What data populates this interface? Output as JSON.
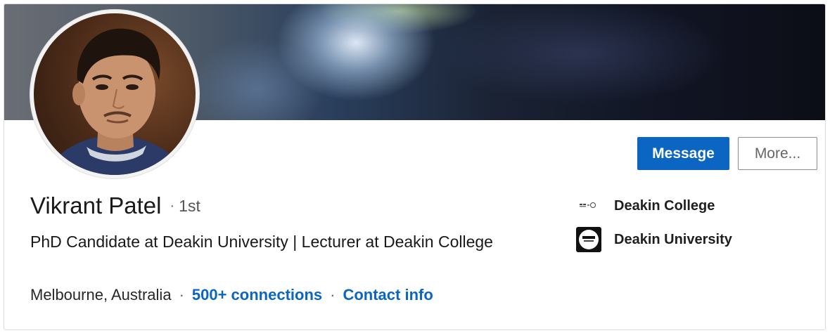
{
  "profile": {
    "name": "Vikrant Patel",
    "separator": "·",
    "degree": "1st",
    "headline": "PhD Candidate at Deakin University | Lecturer at Deakin College",
    "location": "Melbourne, Australia",
    "connections": "500+ connections",
    "contact_info": "Contact info"
  },
  "actions": {
    "message_label": "Message",
    "more_label": "More..."
  },
  "organizations": [
    {
      "name": "Deakin College",
      "icon": "deakin-college-logo-icon"
    },
    {
      "name": "Deakin University",
      "icon": "deakin-university-logo-icon"
    }
  ],
  "colors": {
    "accent": "#0a66c2",
    "banner_dark": "#111524"
  }
}
